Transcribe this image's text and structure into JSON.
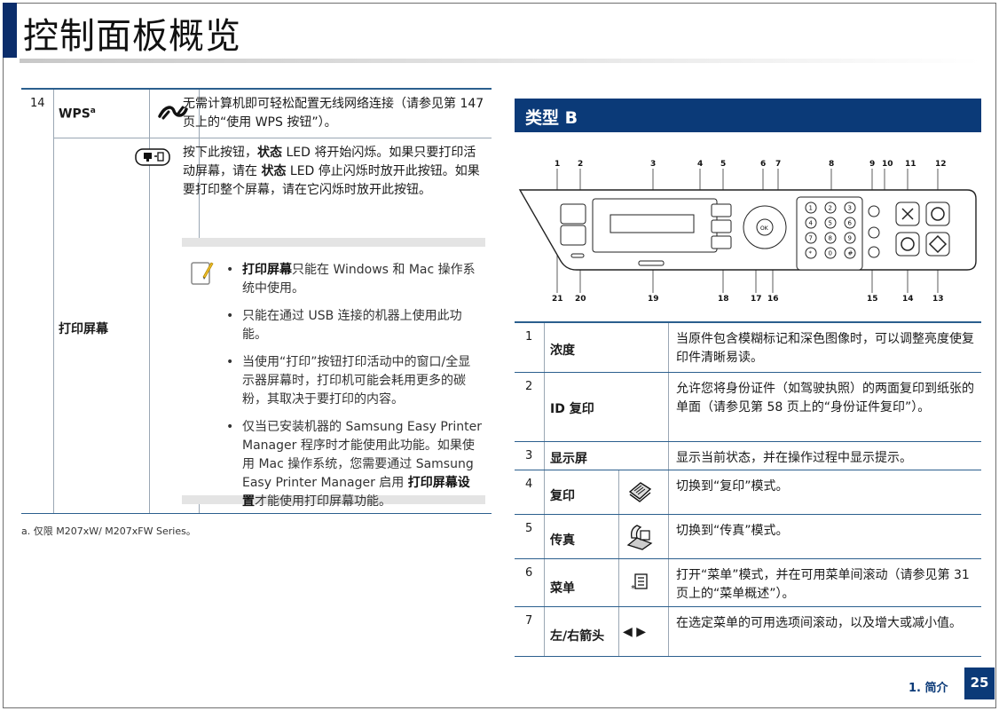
{
  "page": {
    "title": "控制面板概览",
    "page_number": "25",
    "section_footer": "1. 简介",
    "colors": {
      "navy": "#0b3a78",
      "table_rule": "#2b5f8e"
    }
  },
  "left_table": {
    "row14": {
      "number": "14",
      "wps_label": "WPS",
      "wps_sup": "a",
      "wps_icon": "wps-icon",
      "wps_desc": "无需计算机即可轻松配置无线网络连接（请参见第 147 页上的“使用 WPS 按钮”）。",
      "print_screen_label": "打印屏幕",
      "print_screen_icon": "print-screen-icon",
      "print_screen_desc_1": "按下此按钮，",
      "print_screen_desc_b1": "状态",
      "print_screen_desc_2": " LED 将开始闪烁。如果只要打印活动屏幕，请在 ",
      "print_screen_desc_b2": "状态",
      "print_screen_desc_3": " LED 停止闪烁时放开此按钮。如果要打印整个屏幕，请在它闪烁时放开此按钮。"
    },
    "note": {
      "icon": "note-pencil-icon",
      "items": [
        {
          "bold": "打印屏幕",
          "text": "只能在 Windows 和 Mac 操作系统中使用。"
        },
        {
          "bold": "",
          "text": "只能在通过 USB 连接的机器上使用此功能。"
        },
        {
          "bold": "",
          "text": "当使用“打印”按钮打印活动中的窗口/全显示器屏幕时，打印机可能会耗用更多的碳粉，其取决于要打印的内容。"
        },
        {
          "text_pre": "仅当已安装机器的 Samsung Easy Printer Manager 程序时才能使用此功能。如果使用 Mac 操作系统，您需要通过 Samsung Easy Printer Manager 启用 ",
          "bold": "打印屏幕设置",
          "text_post": "才能使用打印屏幕功能。"
        }
      ]
    },
    "footnote": "a. 仅限 M207xW/ M207xFW Series。"
  },
  "section": {
    "heading": "类型 B"
  },
  "diagram": {
    "callouts_top": [
      "1",
      "2",
      "3",
      "4",
      "5",
      "6",
      "7",
      "8",
      "9",
      "10",
      "11",
      "12"
    ],
    "callouts_bottom": [
      "21",
      "20",
      "19",
      "18",
      "17",
      "16",
      "15",
      "14",
      "13"
    ]
  },
  "right_table": [
    {
      "number": "1",
      "label": "浓度",
      "icon": "",
      "desc": "当原件包含模糊标记和深色图像时，可以调整亮度使复印件清晰易读。"
    },
    {
      "number": "2",
      "label": "ID 复印",
      "icon": "",
      "desc": "允许您将身份证件（如驾驶执照）的两面复印到纸张的单面（请参见第 58 页上的“身份证件复印”）。"
    },
    {
      "number": "3",
      "label": "显示屏",
      "icon": "",
      "desc": "显示当前状态，并在操作过程中显示提示。"
    },
    {
      "number": "4",
      "label": "复印",
      "icon": "copy-icon",
      "desc": "切换到“复印”模式。"
    },
    {
      "number": "5",
      "label": "传真",
      "icon": "fax-icon",
      "desc": "切换到“传真”模式。"
    },
    {
      "number": "6",
      "label": "菜单",
      "icon": "menu-icon",
      "desc": "打开“菜单”模式，并在可用菜单间滚动（请参见第 31 页上的“菜单概述”）。"
    },
    {
      "number": "7",
      "label": "左/右箭头",
      "icon": "left-right-arrows-icon",
      "icon_text": "◀ ▶",
      "desc": "在选定菜单的可用选项间滚动，以及增大或减小值。"
    }
  ]
}
